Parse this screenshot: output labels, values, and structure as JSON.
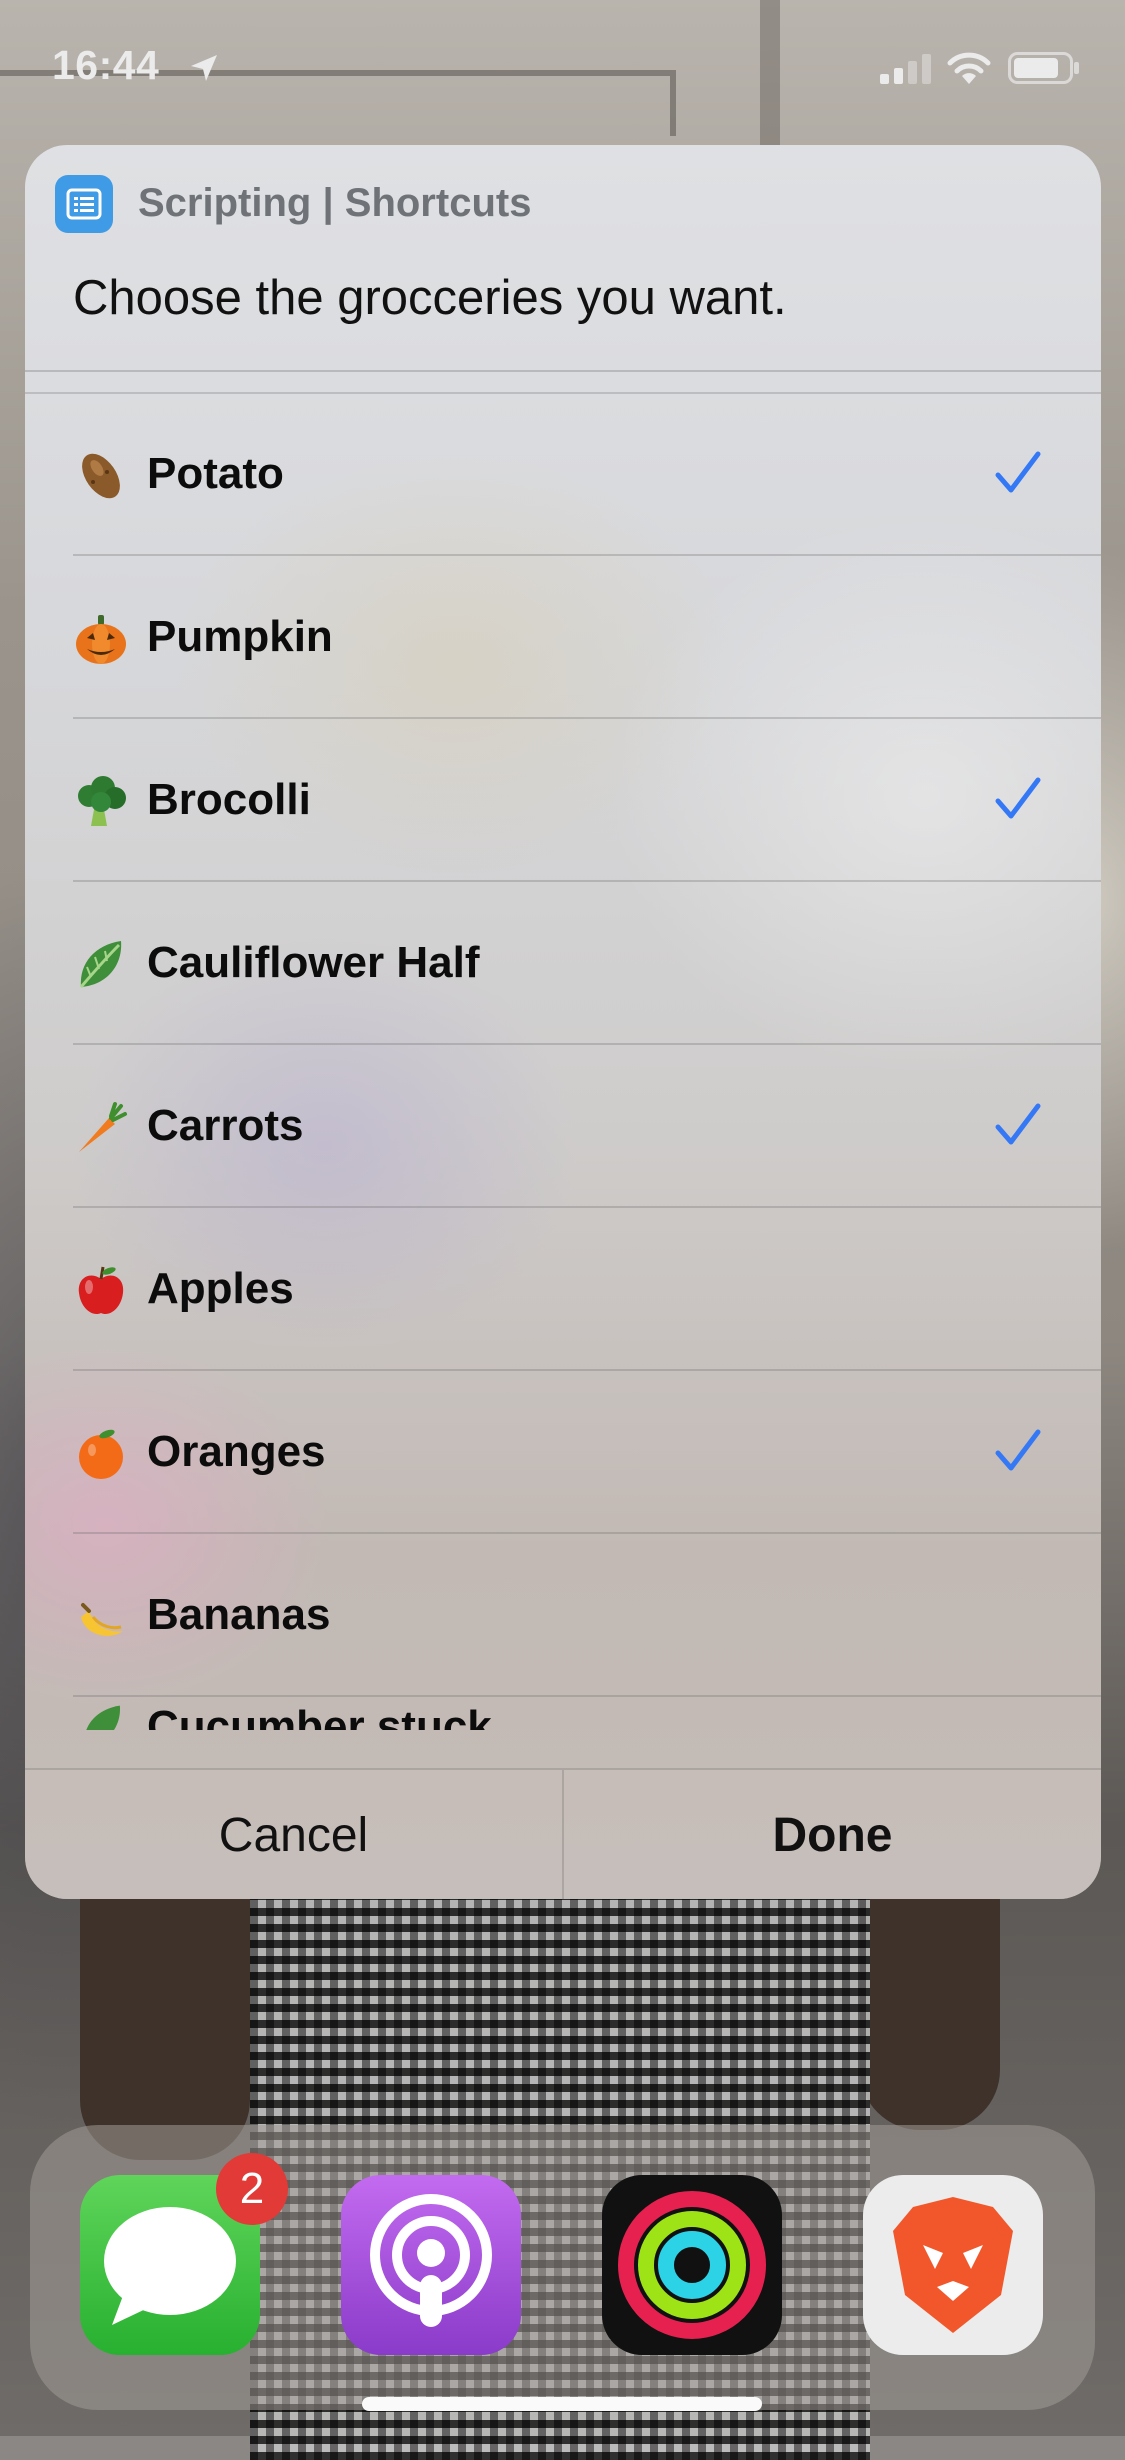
{
  "status_bar": {
    "time": "16:44",
    "icons": [
      "location-arrow-icon",
      "cellular-signal-icon",
      "wifi-icon",
      "battery-icon"
    ]
  },
  "dialog": {
    "app_name": "Scripting | Shortcuts",
    "app_icon": "scripting-app-icon",
    "prompt": "Choose the grocceries you want.",
    "items": [
      {
        "label": "Potato",
        "emoji": "potato-icon",
        "selected": true
      },
      {
        "label": "Pumpkin",
        "emoji": "jack-o-lantern-icon",
        "selected": false
      },
      {
        "label": "Brocolli",
        "emoji": "broccoli-icon",
        "selected": true
      },
      {
        "label": "Cauliflower Half",
        "emoji": "leafy-green-icon",
        "selected": false
      },
      {
        "label": "Carrots",
        "emoji": "carrot-icon",
        "selected": true
      },
      {
        "label": "Apples",
        "emoji": "red-apple-icon",
        "selected": false
      },
      {
        "label": "Oranges",
        "emoji": "orange-icon",
        "selected": true
      },
      {
        "label": "Bananas",
        "emoji": "banana-icon",
        "selected": false
      }
    ],
    "partial_item_label": "Cucumber stuck",
    "cancel_label": "Cancel",
    "done_label": "Done",
    "accent_color": "#3478f6"
  },
  "dock": {
    "apps": [
      "messages-app-icon",
      "podcasts-app-icon",
      "fitness-app-icon",
      "brave-app-icon"
    ],
    "messages_badge": "2"
  }
}
